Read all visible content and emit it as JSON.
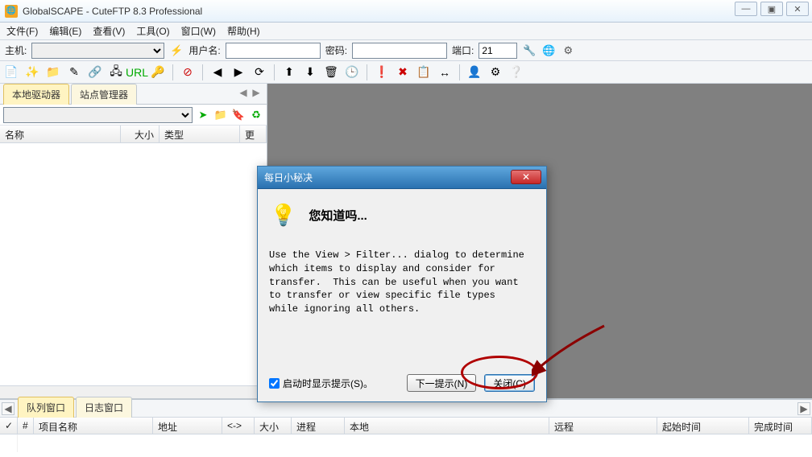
{
  "window": {
    "title": "GlobalSCAPE - CuteFTP 8.3 Professional"
  },
  "menu": {
    "file": "文件(F)",
    "edit": "编辑(E)",
    "view": "查看(V)",
    "tools": "工具(O)",
    "window": "窗口(W)",
    "help": "帮助(H)"
  },
  "conn": {
    "host_label": "主机:",
    "host_value": "",
    "user_label": "用户名:",
    "user_value": "",
    "pass_label": "密码:",
    "pass_value": "",
    "port_label": "端口:",
    "port_value": "21"
  },
  "left": {
    "tab1": "本地驱动器",
    "tab2": "站点管理器",
    "path": "",
    "cols": {
      "name": "名称",
      "size": "大小",
      "type": "类型",
      "more": "更"
    }
  },
  "bottom": {
    "tab1": "队列窗口",
    "tab2": "日志窗口",
    "cols": {
      "num": "#",
      "item": "项目名称",
      "addr": "地址",
      "arrow": "<->",
      "size": "大小",
      "prog": "进程",
      "local": "本地",
      "remote": "远程",
      "start": "起始时间",
      "end": "完成时间"
    }
  },
  "dialog": {
    "title": "每日小秘决",
    "heading": "您知道吗...",
    "tip": "Use the View > Filter... dialog to determine\nwhich items to display and consider for\ntransfer.  This can be useful when you want\nto transfer or view specific file types\nwhile ignoring all others.",
    "show_on_start": "启动时显示提示(S)。",
    "next": "下一提示(N)",
    "close": "关闭(C)"
  }
}
